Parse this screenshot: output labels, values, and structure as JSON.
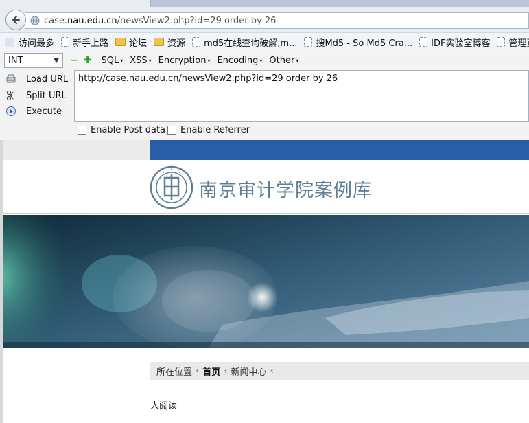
{
  "browser": {
    "url_prefix": "case.",
    "url_domain": "nau.edu.cn",
    "url_path": "/newsView2.php?id=29 order by 26"
  },
  "bookmarks": [
    {
      "label": "访问最多",
      "icon": "star-page-icon"
    },
    {
      "label": "新手上路",
      "icon": "page-icon"
    },
    {
      "label": "论坛",
      "icon": "folder-icon"
    },
    {
      "label": "资源",
      "icon": "folder-icon"
    },
    {
      "label": "md5在线查询破解,m...",
      "icon": "page-icon"
    },
    {
      "label": "搜Md5 - So Md5 Cra...",
      "icon": "page-icon"
    },
    {
      "label": "IDF实验室博客",
      "icon": "page-icon"
    },
    {
      "label": "管理页面-公众",
      "icon": "page-icon"
    }
  ],
  "hackbar": {
    "select_value": "INT",
    "menus": [
      "SQL",
      "XSS",
      "Encryption",
      "Encoding",
      "Other"
    ],
    "load_url": "Load URL",
    "split_url": "Split URL",
    "execute": "Execute",
    "url_value": "http://case.nau.edu.cn/newsView2.php?id=29 order by 26",
    "enable_post": "Enable Post data",
    "enable_referrer": "Enable Referrer"
  },
  "site": {
    "title": "南京审计学院案例库",
    "breadcrumb": {
      "location_label": "所在位置",
      "home": "首页",
      "section": "新闻中心"
    },
    "reads_text": "人阅读"
  },
  "colors": {
    "blue_bar": "#2b5da6",
    "title": "#5f7f94"
  }
}
